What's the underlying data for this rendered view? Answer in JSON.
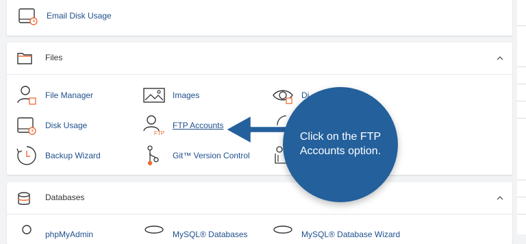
{
  "top_panel": {
    "items": [
      {
        "label": "Email Disk Usage",
        "icon": "disk-clock-icon"
      }
    ]
  },
  "files": {
    "title": "Files",
    "header_icon": "folder-icon",
    "items": [
      {
        "label": "File Manager",
        "icon": "user-file-icon"
      },
      {
        "label": "Images",
        "icon": "image-icon"
      },
      {
        "label": "Di",
        "icon": "eye-privacy-icon"
      },
      {
        "label": "Disk Usage",
        "icon": "disk-clock-icon"
      },
      {
        "label": "FTP Accounts",
        "icon": "user-ftp-icon"
      },
      {
        "label": "Backup Wizard",
        "icon": "backup-clock-icon"
      },
      {
        "label": "Git™ Version Control",
        "icon": "git-branch-icon"
      }
    ]
  },
  "databases": {
    "title": "Databases",
    "header_icon": "database-icon",
    "items": [
      {
        "label": "phpMyAdmin"
      },
      {
        "label": "MySQL® Databases"
      },
      {
        "label": "MySQL® Database Wizard"
      }
    ]
  },
  "callout": {
    "line1": "Click on the FTP",
    "line2": "Accounts option."
  },
  "colors": {
    "accent": "#23609c",
    "link": "#1e4e8c",
    "icon_orange": "#f06a35"
  }
}
